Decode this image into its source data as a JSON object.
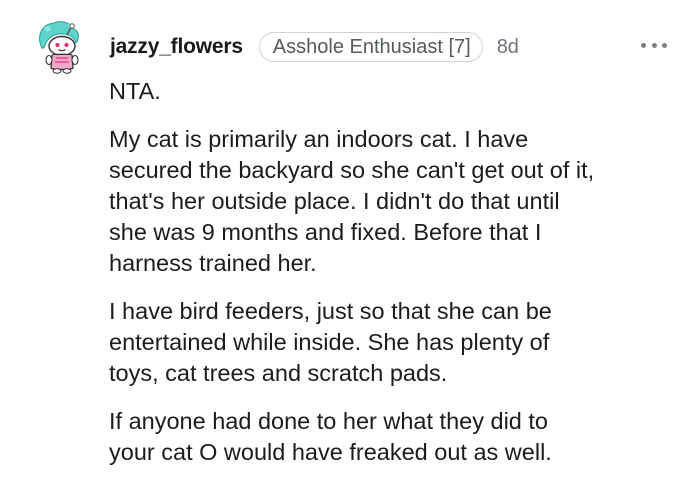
{
  "comment": {
    "author": "jazzy_flowers",
    "flair": "Asshole Enthusiast [7]",
    "age": "8d",
    "avatar_icon": "snoo-avatar-icon",
    "more_icon": "more-options-icon",
    "paragraphs": [
      "NTA.",
      "My cat is primarily an indoors cat. I have\nsecured the backyard so she can't get out of it,\nthat's her outside place. I didn't do that until\nshe was 9 months and fixed. Before that I\nharness trained her.",
      "I have bird feeders, just so that she can be\nentertained while inside. She has plenty of\ntoys, cat trees and scratch pads.",
      "If anyone had done to her what they did to\nyour cat O would have freaked out as well."
    ]
  },
  "colors": {
    "text": "#1c1c1c",
    "meta": "#6f7479",
    "flair_border": "#d0d3d6",
    "avatar_hair": "#5ed3c9",
    "avatar_accent": "#e0337a"
  }
}
